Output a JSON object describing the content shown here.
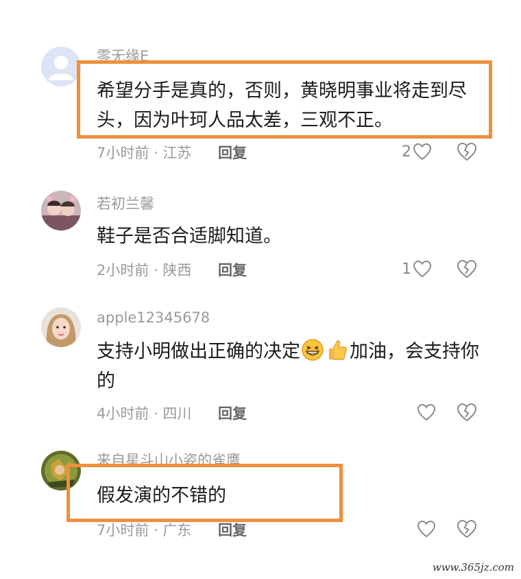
{
  "comments": [
    {
      "username": "零无缘E",
      "text": "希望分手是真的，否则，黄晓明事业将走到尽头，因为叶珂人品太差，三观不正。",
      "meta": "7小时前 · 江苏",
      "reply_label": "回复",
      "like_count": "2",
      "avatar": "default-avatar-icon"
    },
    {
      "username": "若初兰馨",
      "text": "鞋子是否合适脚知道。",
      "meta": "2小时前 · 陕西",
      "reply_label": "回复",
      "like_count": "1",
      "avatar": "photo-avatar-children"
    },
    {
      "username": "apple12345678",
      "text_parts": [
        "支持小明做出正确的决定",
        "加油，会支持你的"
      ],
      "emojis": [
        "grinning-face-icon",
        "thumbs-up-icon"
      ],
      "meta": "4小时前 · 四川",
      "reply_label": "回复",
      "like_count": "",
      "avatar": "photo-avatar-woman"
    },
    {
      "username": "来自星斗山小姿的雀鹰",
      "text": "假发演的不错的",
      "meta": "7小时前 · 广东",
      "reply_label": "回复",
      "like_count": "",
      "avatar": "photo-avatar-game-character"
    }
  ],
  "watermark": "www.365jz.com",
  "colors": {
    "highlight": "#ef8f3c",
    "meta": "#9a9a9a",
    "text": "#1b1b1b"
  }
}
